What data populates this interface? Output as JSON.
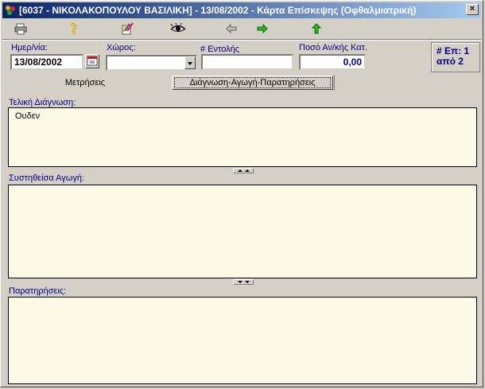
{
  "window": {
    "title": "[6037 - ΝΙΚΟΛΑΚΟΠΟΥΛΟΥ ΒΑΣΙΛΙΚΗ] - 13/08/2002 - Κάρτα Επίσκεψης (Οφθαλμιατρική)",
    "close_label": "×"
  },
  "toolbar": {
    "icons": [
      "printer-icon",
      "treatment-icon",
      "edit-icon",
      "eye-icon",
      "arrow-left-icon",
      "arrow-right-icon",
      "arrow-up-icon"
    ]
  },
  "header": {
    "date_label": "Ημερ/νία:",
    "date_value": "13/08/2002",
    "room_label": "Χώρος:",
    "room_value": "",
    "order_label": "# Εντολής",
    "order_value": "",
    "amount_label": "Ποσό Αν/κής Κατ.",
    "amount_value": "0,00",
    "visit_count_line1": "# Επ: 1",
    "visit_count_line2": "από 2"
  },
  "tabs": [
    {
      "label": "Μετρήσεις",
      "active": false
    },
    {
      "label": "Διάγνωση-Αγωγή-Παρατηρήσεις",
      "active": true
    }
  ],
  "sections": {
    "diagnosis_label": "Τελική Διάγνωση:",
    "diagnosis_value": "Ουδεν",
    "treatment_label": "Συστηθείσα Αγωγή:",
    "treatment_value": "",
    "notes_label": "Παρατηρήσεις:",
    "notes_value": ""
  },
  "colors": {
    "title_bar": "#0a246a",
    "label_text": "#000080",
    "memo_bg": "#fdf9e7"
  }
}
